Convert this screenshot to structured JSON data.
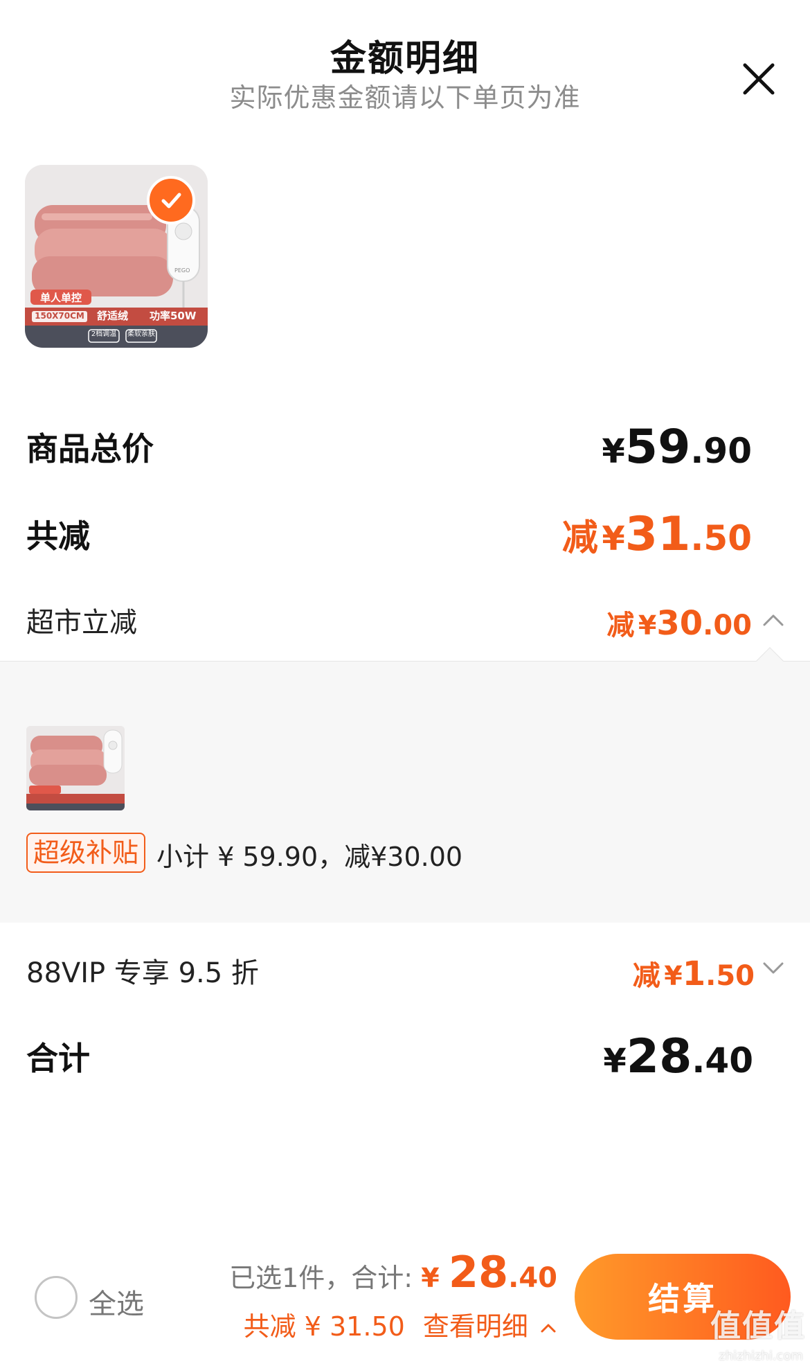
{
  "header": {
    "title": "金额明细",
    "subtitle": "实际优惠金额请以下单页为准"
  },
  "product": {
    "tag_single": "单人单控",
    "spec_size": "150X70CM",
    "spec_material": "舒适绒",
    "spec_power": "功率50W",
    "spec_mode": "2档调温",
    "spec_soft": "柔软亲肤",
    "brand": "PEGO"
  },
  "total_price": {
    "label": "商品总价",
    "symbol": "¥",
    "int": "59",
    "dec": ".90"
  },
  "total_discount": {
    "label": "共减",
    "prefix": "减",
    "symbol": "¥",
    "int": "31",
    "dec": ".50"
  },
  "supermarket_discount": {
    "label": "超市立减",
    "prefix": "减",
    "symbol": "¥",
    "int": "30",
    "dec": ".00"
  },
  "detail": {
    "tag": "超级补贴",
    "subtotal": "小计 ¥ 59.90，减¥30.00"
  },
  "vip_discount": {
    "label": "88VIP 专享 9.5 折",
    "prefix": "减",
    "symbol": "¥",
    "int": "1",
    "dec": ".50"
  },
  "grand_total": {
    "label": "合计",
    "symbol": "¥",
    "int": "28",
    "dec": ".40"
  },
  "bottom": {
    "select_all": "全选",
    "selected_prefix": "已选1件，合计: ",
    "symbol": "¥ ",
    "int": "28",
    "dec": ".40",
    "saved": "共减 ¥ 31.50",
    "view_detail": "查看明细",
    "checkout": "结算"
  },
  "watermark": {
    "logo": "值值值",
    "url": "zhizhizhi.com"
  },
  "colors": {
    "accent": "#f25c19",
    "checkout_from": "#ff9a2a",
    "checkout_to": "#ff5a1f"
  }
}
